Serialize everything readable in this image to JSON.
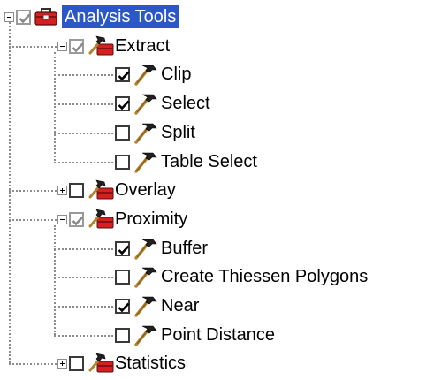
{
  "tree": {
    "root": {
      "label": "Analysis Tools",
      "check": "tri",
      "icon": "toolbox-icon",
      "expanded": true,
      "selected": true
    },
    "nodes": [
      {
        "label": "Extract",
        "level": 1,
        "type": "toolset",
        "check": "tri",
        "expander": "minus"
      },
      {
        "label": "Clip",
        "level": 2,
        "type": "tool",
        "check": "on"
      },
      {
        "label": "Select",
        "level": 2,
        "type": "tool",
        "check": "on"
      },
      {
        "label": "Split",
        "level": 2,
        "type": "tool",
        "check": "off"
      },
      {
        "label": "Table Select",
        "level": 2,
        "type": "tool",
        "check": "off"
      },
      {
        "label": "Overlay",
        "level": 1,
        "type": "toolset",
        "check": "off",
        "expander": "plus"
      },
      {
        "label": "Proximity",
        "level": 1,
        "type": "toolset",
        "check": "tri",
        "expander": "minus"
      },
      {
        "label": "Buffer",
        "level": 2,
        "type": "tool",
        "check": "on"
      },
      {
        "label": "Create Thiessen Polygons",
        "level": 2,
        "type": "tool",
        "check": "off"
      },
      {
        "label": "Near",
        "level": 2,
        "type": "tool",
        "check": "on"
      },
      {
        "label": "Point Distance",
        "level": 2,
        "type": "tool",
        "check": "off"
      },
      {
        "label": "Statistics",
        "level": 1,
        "type": "toolset",
        "check": "off",
        "expander": "plus"
      }
    ]
  },
  "colors": {
    "selection": "#2b57c7",
    "connector": "#8c8c8c",
    "toolbox": "#d42020",
    "hammer_head": "#202020",
    "hammer_handle": "#b5832e"
  }
}
